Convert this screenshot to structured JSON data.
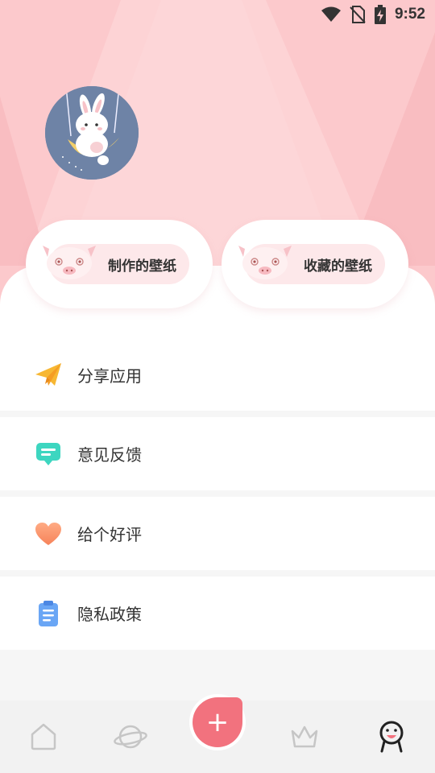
{
  "status_bar": {
    "time": "9:52"
  },
  "shortcuts": [
    {
      "label": "制作的壁纸"
    },
    {
      "label": "收藏的壁纸"
    }
  ],
  "menu": [
    {
      "label": "分享应用",
      "icon": "paper-plane-icon"
    },
    {
      "label": "意见反馈",
      "icon": "feedback-chat-icon"
    },
    {
      "label": "给个好评",
      "icon": "heart-icon"
    },
    {
      "label": "隐私政策",
      "icon": "clipboard-icon"
    }
  ],
  "bottom_nav": {
    "items": [
      {
        "icon": "home-icon"
      },
      {
        "icon": "planet-icon"
      },
      {
        "icon": "add-icon",
        "glyph": "+"
      },
      {
        "icon": "crown-icon"
      },
      {
        "icon": "profile-icon",
        "active": true
      }
    ]
  },
  "colors": {
    "header_pink": "#fcc9cc",
    "pill_pink": "#fde8ea",
    "fab_red": "#f2727e",
    "avatar_blue": "#6e83a6"
  }
}
